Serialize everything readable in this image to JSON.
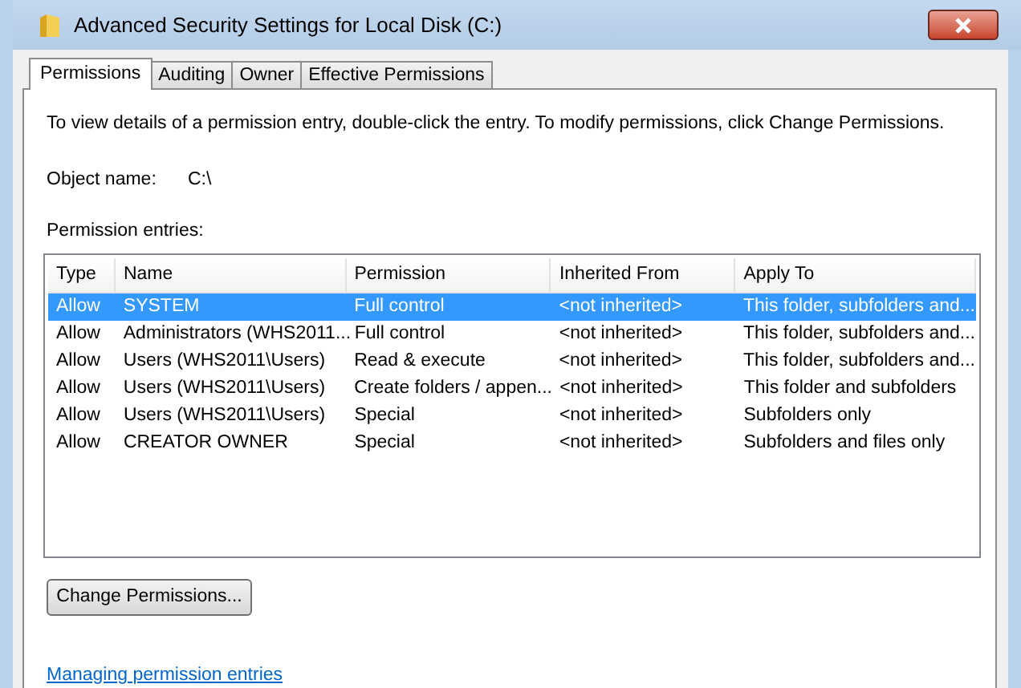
{
  "window": {
    "title": "Advanced Security Settings for Local Disk (C:)"
  },
  "tabs": [
    {
      "label": "Permissions",
      "selected": true
    },
    {
      "label": "Auditing",
      "selected": false
    },
    {
      "label": "Owner",
      "selected": false
    },
    {
      "label": "Effective Permissions",
      "selected": false
    }
  ],
  "instructions": "To view details of a permission entry, double-click the entry. To modify permissions, click Change Permissions.",
  "object_name": {
    "label": "Object name:",
    "value": "C:\\"
  },
  "entries_label": "Permission entries:",
  "table": {
    "columns": [
      "Type",
      "Name",
      "Permission",
      "Inherited From",
      "Apply To"
    ],
    "rows": [
      {
        "cells": [
          "Allow",
          "SYSTEM",
          "Full control",
          "<not inherited>",
          "This folder, subfolders and..."
        ],
        "selected": true
      },
      {
        "cells": [
          "Allow",
          "Administrators (WHS2011...",
          "Full control",
          "<not inherited>",
          "This folder, subfolders and..."
        ],
        "selected": false
      },
      {
        "cells": [
          "Allow",
          "Users (WHS2011\\Users)",
          "Read & execute",
          "<not inherited>",
          "This folder, subfolders and..."
        ],
        "selected": false
      },
      {
        "cells": [
          "Allow",
          "Users (WHS2011\\Users)",
          "Create folders / appen...",
          "<not inherited>",
          "This folder and subfolders"
        ],
        "selected": false
      },
      {
        "cells": [
          "Allow",
          "Users (WHS2011\\Users)",
          "Special",
          "<not inherited>",
          "Subfolders only"
        ],
        "selected": false
      },
      {
        "cells": [
          "Allow",
          "CREATOR OWNER",
          "Special",
          "<not inherited>",
          "Subfolders and files only"
        ],
        "selected": false
      }
    ]
  },
  "change_button": "Change Permissions...",
  "help_link": "Managing permission entries"
}
